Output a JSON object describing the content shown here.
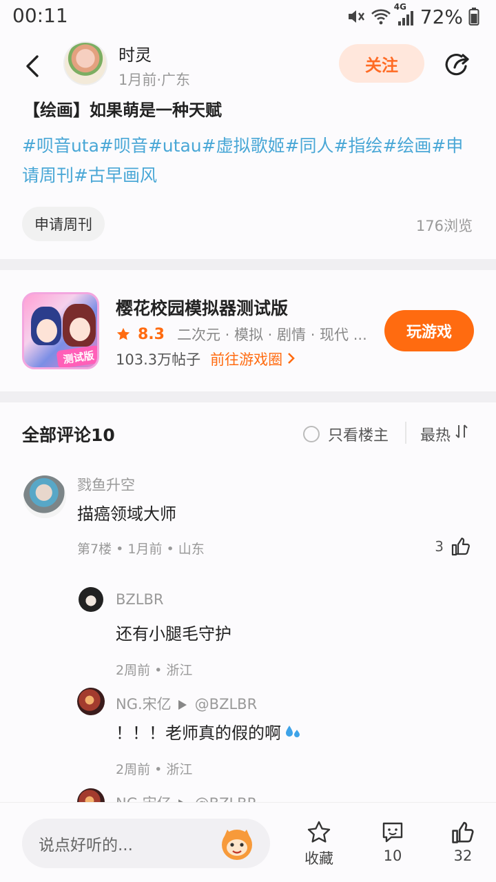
{
  "status_bar": {
    "time": "00:11",
    "network": "4G",
    "battery": "72%"
  },
  "header": {
    "author_name": "时灵",
    "author_meta": "1月前·广东",
    "follow_label": "关注"
  },
  "post": {
    "title": "【绘画】如果萌是一种天赋",
    "tags": "#呗音uta#呗音#utau#虚拟歌姬#同人#指绘#绘画#申请周刊#古早画风",
    "chip_label": "申请周刊",
    "views": "176浏览"
  },
  "game_card": {
    "name": "樱花校园模拟器测试版",
    "rating": "8.3",
    "genres": "二次元 · 模拟 · 剧情 · 现代 ...",
    "post_count": "103.3万帖子",
    "circle_link": "前往游戏圈",
    "play_label": "玩游戏",
    "icon_badge": "测试版"
  },
  "comments_header": {
    "title": "全部评论10",
    "owner_only_label": "只看楼主",
    "sort_label": "最热"
  },
  "comments": {
    "c1": {
      "name": "戮鱼升空",
      "text": "描癌领域大师",
      "meta": "第7楼 • 1月前 • 山东",
      "likes": "3"
    },
    "r1": {
      "name": "BZLBR",
      "text": "还有小腿毛守护",
      "meta": "2周前 • 浙江"
    },
    "r2": {
      "name": "NG.宋亿",
      "reply_to": "@BZLBR",
      "text": "！！！老师真的假的啊",
      "meta": "2周前 • 浙江"
    },
    "r3": {
      "name": "NG.宋亿",
      "reply_to": "@BZLBR"
    }
  },
  "bottom_bar": {
    "input_placeholder": "说点好听的...",
    "favorite_label": "收藏",
    "comment_count": "10",
    "like_count": "32"
  },
  "colors": {
    "accent": "#ff6b10",
    "tag": "#49a7d6",
    "follow_bg": "#ffe7dc"
  }
}
